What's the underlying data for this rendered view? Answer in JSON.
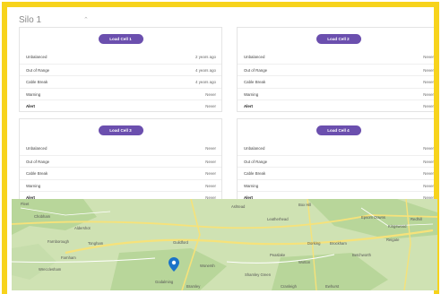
{
  "silo": {
    "title": "Silo 1",
    "caret": "⌃"
  },
  "cards": [
    {
      "title": "Load Cell 1",
      "rows": [
        {
          "label": "Unbalanced",
          "value": "2 years ago"
        },
        {
          "label": "Out of Range",
          "value": "4 years ago"
        },
        {
          "label": "Cable Break",
          "value": "4 years ago"
        },
        {
          "label": "Warning",
          "value": "Never"
        },
        {
          "label": "Alert",
          "value": "Never"
        }
      ]
    },
    {
      "title": "Load Cell 2",
      "rows": [
        {
          "label": "Unbalanced",
          "value": "Never"
        },
        {
          "label": "Out of Range",
          "value": "Never"
        },
        {
          "label": "Cable Break",
          "value": "Never"
        },
        {
          "label": "Warning",
          "value": "Never"
        },
        {
          "label": "Alert",
          "value": "Never"
        }
      ]
    },
    {
      "title": "Load Cell 3",
      "rows": [
        {
          "label": "Unbalanced",
          "value": "Never"
        },
        {
          "label": "Out of Range",
          "value": "Never"
        },
        {
          "label": "Cable Break",
          "value": "Never"
        },
        {
          "label": "Warning",
          "value": "Never"
        },
        {
          "label": "Alert",
          "value": "Never"
        }
      ]
    },
    {
      "title": "Load Cell 4",
      "rows": [
        {
          "label": "Unbalanced",
          "value": "Never"
        },
        {
          "label": "Out of Range",
          "value": "Never"
        },
        {
          "label": "Cable Break",
          "value": "Never"
        },
        {
          "label": "Warning",
          "value": "Never"
        },
        {
          "label": "Alert",
          "value": "Never"
        }
      ]
    }
  ],
  "map": {
    "places": [
      "Fleet",
      "Chobham",
      "Aldershot",
      "Farnborough",
      "Tongham",
      "Farnham",
      "Wrecclesham",
      "Guildford",
      "Wonersh",
      "Godalming",
      "Shamley Green",
      "Box Hill",
      "Dorking",
      "Brockham",
      "Reigate",
      "Betchworth",
      "Ashtead",
      "Leatherhead",
      "Redhill",
      "Epsom Downs",
      "Kingswood",
      "Bramley",
      "Cranleigh",
      "Ewhurst",
      "Peaslake",
      "Wotton"
    ],
    "colors": {
      "land": "#cfe2b3",
      "forest": "#b8d69a",
      "road": "#f6e27a",
      "marker": "#1a73c8"
    },
    "icons": [
      "map-pin-icon"
    ]
  },
  "colors": {
    "frame": "#f7d31c",
    "pill": "#6b4fae"
  }
}
